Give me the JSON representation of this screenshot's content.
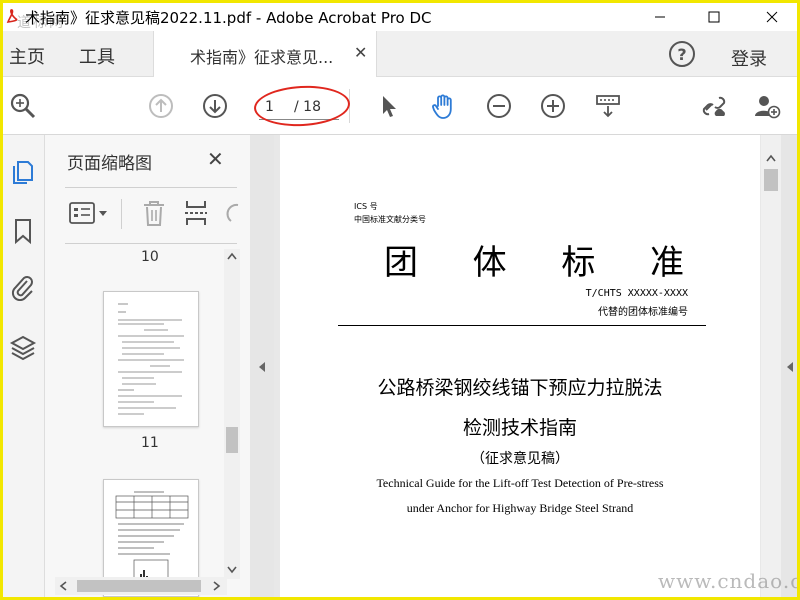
{
  "window": {
    "title": "术指南》征求意见稿2022.11.pdf - Adobe Acrobat Pro DC",
    "watermark_top": "道标网",
    "watermark_bottom": "www.cndao.com"
  },
  "menubar": {
    "home": "主页",
    "tools": "工具",
    "doc_tab": "术指南》征求意见...",
    "login": "登录",
    "help": "?"
  },
  "toolbar": {
    "current_page": "1",
    "total_pages": "/ 18"
  },
  "thumbnails": {
    "title": "页面缩略图",
    "pages": [
      "10",
      "11"
    ]
  },
  "document": {
    "ics": "ICS 号",
    "clc": "中国标准文献分类号",
    "main_title_chars": [
      "团",
      "体",
      "标",
      "准"
    ],
    "standard_no": "T/CHTS XXXXX-XXXX",
    "replaces": "代替的团体标准编号",
    "title_cn_line1": "公路桥梁钢绞线锚下预应力拉脱法",
    "title_cn_line2": "检测技术指南",
    "draft_note": "（征求意见稿）",
    "title_en_line1": "Technical Guide for the Lift-off Test Detection of Pre-stress",
    "title_en_line2": "under Anchor for Highway Bridge Steel Strand"
  },
  "colors": {
    "accent_blue": "#2d7bd6",
    "annotation_red": "#e0271e",
    "frame_yellow": "#f2e700"
  }
}
